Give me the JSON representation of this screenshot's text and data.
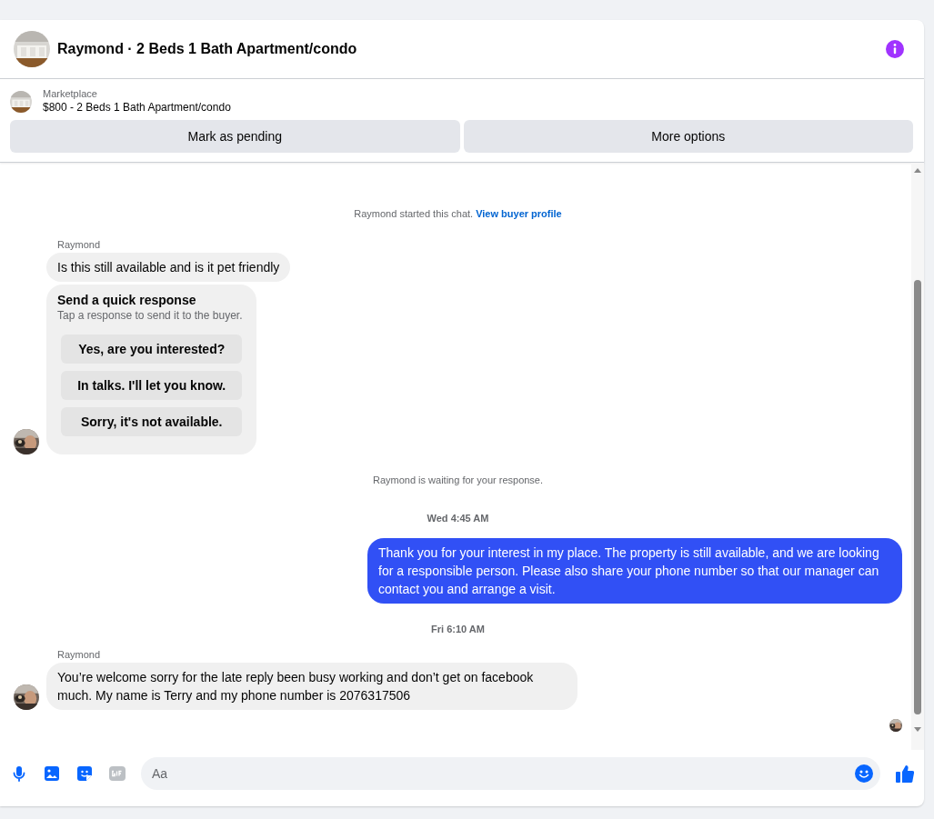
{
  "header": {
    "title": "Raymond · 2 Beds 1 Bath Apartment/condo"
  },
  "listing": {
    "source": "Marketplace",
    "title": "$800 - 2 Beds 1 Bath Apartment/condo",
    "actions": [
      "Mark as pending",
      "More options"
    ]
  },
  "messages": [
    {
      "kind": "system",
      "text": "Raymond started this chat.",
      "link": "View buyer profile"
    },
    {
      "kind": "incoming",
      "sender": "Raymond",
      "text": "Is this still available and is it pet friendly"
    },
    {
      "kind": "quick_response",
      "title": "Send a quick response",
      "hint": "Tap a response to send it to the buyer.",
      "options": [
        "Yes, are you interested?",
        "In talks. I'll let you know.",
        "Sorry, it's not available."
      ]
    },
    {
      "kind": "system",
      "text": "Raymond is waiting for your response."
    },
    {
      "kind": "time",
      "text": "Wed 4:45 AM"
    },
    {
      "kind": "outgoing",
      "text": "Thank you for your interest in my place. The property is still available, and we are looking for a responsible person. Please also share your phone number so that our manager can contact you and arrange a visit."
    },
    {
      "kind": "time",
      "text": "Fri 6:10 AM"
    },
    {
      "kind": "incoming",
      "sender": "Raymond",
      "text": "You’re welcome sorry for the late reply been busy working and don’t get on facebook much. My name is Terry and my phone number is 2076317506"
    }
  ],
  "composer": {
    "placeholder": "Aa"
  }
}
